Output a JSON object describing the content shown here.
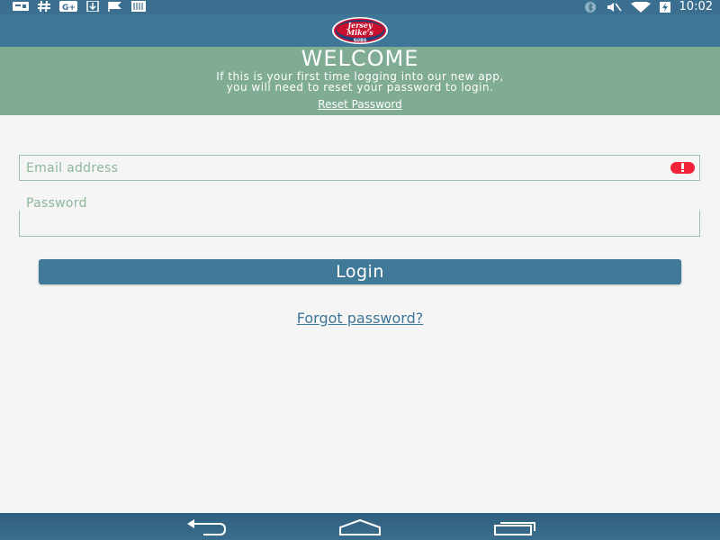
{
  "status_bar": {
    "time": "10:02",
    "icons_left": [
      "notification-card-icon",
      "hashtag-icon",
      "google-plus-icon",
      "download-icon",
      "flag-icon",
      "barcode-icon"
    ],
    "icons_right": [
      "bluetooth-icon",
      "vibrate-mute-icon",
      "wifi-icon",
      "battery-charging-icon"
    ]
  },
  "app_bar": {
    "logo_text_top": "Jersey",
    "logo_text_bottom": "Mike's",
    "logo_subtext": "SUBS",
    "brand_color": "#3e7697"
  },
  "welcome": {
    "title": "WELCOME",
    "message_line1": "If this is your first time logging into our new app,",
    "message_line2": "you will need to reset your password to login.",
    "reset_link": "Reset Password",
    "background_color": "#80ac94"
  },
  "form": {
    "email_placeholder": "Email address",
    "password_label": "Password",
    "login_label": "Login",
    "forgot_link": "Forgot password?",
    "error_color": "#f2223a"
  },
  "nav_bar": {
    "buttons": [
      "back-icon",
      "home-icon",
      "recents-icon"
    ]
  }
}
